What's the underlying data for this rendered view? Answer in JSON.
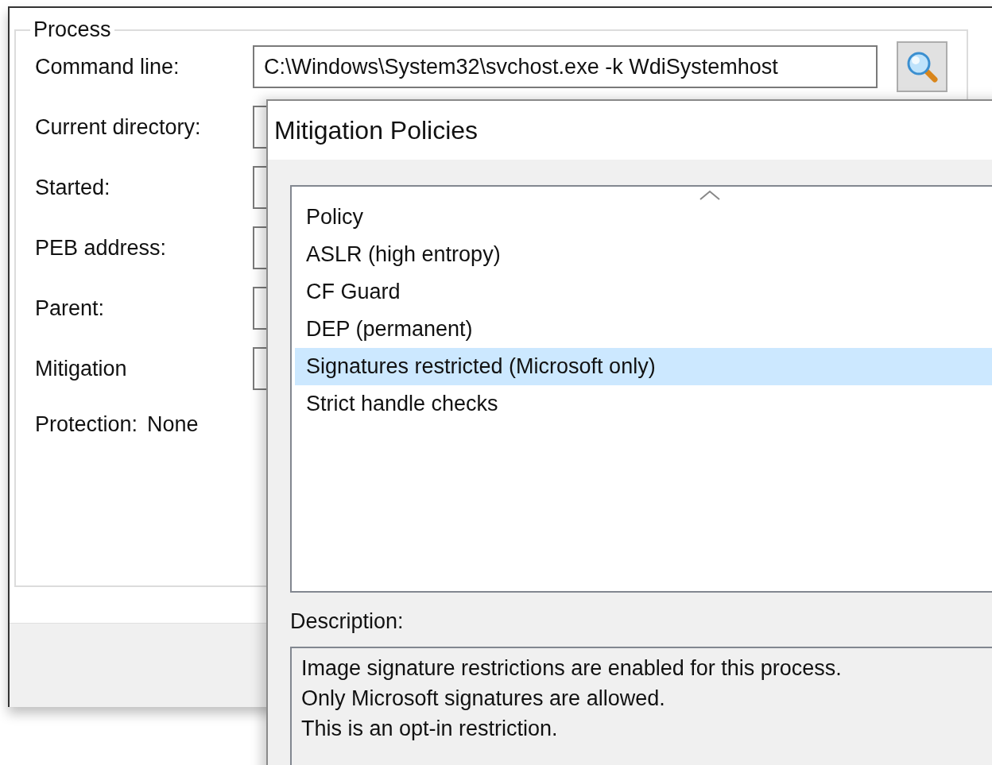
{
  "process": {
    "group_title": "Process",
    "fields": [
      {
        "label": "Command line:",
        "value": "C:\\Windows\\System32\\svchost.exe -k WdiSystemhost"
      },
      {
        "label": "Current directory:"
      },
      {
        "label": "Started:"
      },
      {
        "label": "PEB address:"
      },
      {
        "label": "Parent:"
      },
      {
        "label": "Mitigation"
      }
    ],
    "protection": {
      "label": "Protection:",
      "value": "None"
    }
  },
  "dialog": {
    "title": "Mitigation Policies",
    "list": {
      "column": "Policy",
      "rows": [
        {
          "text": "ASLR (high entropy)",
          "selected": false
        },
        {
          "text": "CF Guard",
          "selected": false
        },
        {
          "text": "DEP (permanent)",
          "selected": false
        },
        {
          "text": "Signatures restricted (Microsoft only)",
          "selected": true
        },
        {
          "text": "Strict handle checks",
          "selected": false
        }
      ]
    },
    "description_label": "Description:",
    "description": [
      "Image signature restrictions are enabled for this process.",
      "Only Microsoft signatures are allowed.",
      "This is an opt-in restriction."
    ]
  }
}
